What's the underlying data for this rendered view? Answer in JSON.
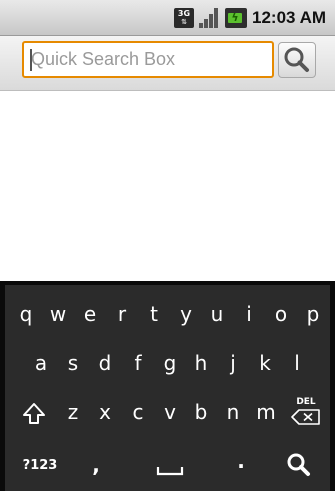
{
  "status_bar": {
    "network_label": "3G",
    "time": "12:03 AM",
    "icons": [
      "3g-icon",
      "signal-icon",
      "battery-charging-icon"
    ]
  },
  "search": {
    "placeholder": "Quick Search Box",
    "value": "",
    "button_icon": "search-icon",
    "accent_color": "#e68a00"
  },
  "keyboard": {
    "row1": [
      "q",
      "w",
      "e",
      "r",
      "t",
      "y",
      "u",
      "i",
      "o",
      "p"
    ],
    "row2": [
      "a",
      "s",
      "d",
      "f",
      "g",
      "h",
      "j",
      "k",
      "l"
    ],
    "row3": [
      "z",
      "x",
      "c",
      "v",
      "b",
      "n",
      "m"
    ],
    "shift_icon": "shift-icon",
    "del_label": "DEL",
    "symbols_label": "?123",
    "comma_label": ",",
    "space_icon": "space-icon",
    "period_label": ".",
    "search_icon": "search-icon"
  }
}
